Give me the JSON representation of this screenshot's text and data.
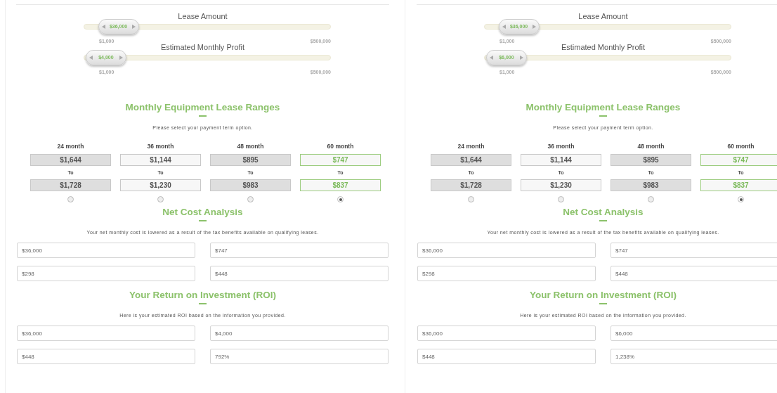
{
  "panels": [
    {
      "sliders": [
        {
          "label": "Lease Amount",
          "value": "$36,000",
          "min": "$1,000",
          "max": "$500,000",
          "level": 0.07
        },
        {
          "label": "Estimated Monthly Profit",
          "value": "$4,000",
          "min": "$1,000",
          "max": "$500,000",
          "level": 0.01
        }
      ],
      "lease_ranges": {
        "title": "Monthly Equipment Lease Ranges",
        "subtitle": "Please select your payment term option.",
        "terms": [
          {
            "label": "24 month",
            "from": "$1,644",
            "separator": "To",
            "to": "$1,728",
            "kind": "shaded",
            "selected": false
          },
          {
            "label": "36 month",
            "from": "$1,144",
            "separator": "To",
            "to": "$1,230",
            "kind": "plain",
            "selected": false
          },
          {
            "label": "48 month",
            "from": "$895",
            "separator": "To",
            "to": "$983",
            "kind": "shaded",
            "selected": false
          },
          {
            "label": "60 month",
            "from": "$747",
            "separator": "To",
            "to": "$837",
            "kind": "plain",
            "selected": true
          }
        ]
      },
      "net_cost": {
        "title": "Net Cost Analysis",
        "subtitle": "Your net monthly cost is lowered as a result of the tax benefits available on qualifying leases.",
        "fields": [
          "$36,000",
          "$747",
          "$298",
          "$448"
        ]
      },
      "roi": {
        "title": "Your Return on Investment (ROI)",
        "subtitle": "Here is your estimated ROI based on the information you provided.",
        "fields": [
          "$36,000",
          "$4,000",
          "$448",
          "792%"
        ]
      }
    },
    {
      "sliders": [
        {
          "label": "Lease Amount",
          "value": "$36,000",
          "min": "$1,000",
          "max": "$500,000",
          "level": 0.07
        },
        {
          "label": "Estimated Monthly Profit",
          "value": "$6,000",
          "min": "$1,000",
          "max": "$500,000",
          "level": 0.01
        }
      ],
      "lease_ranges": {
        "title": "Monthly Equipment Lease Ranges",
        "subtitle": "Please select your payment term option.",
        "terms": [
          {
            "label": "24 month",
            "from": "$1,644",
            "separator": "To",
            "to": "$1,728",
            "kind": "shaded",
            "selected": false
          },
          {
            "label": "36 month",
            "from": "$1,144",
            "separator": "To",
            "to": "$1,230",
            "kind": "plain",
            "selected": false
          },
          {
            "label": "48 month",
            "from": "$895",
            "separator": "To",
            "to": "$983",
            "kind": "shaded",
            "selected": false
          },
          {
            "label": "60 month",
            "from": "$747",
            "separator": "To",
            "to": "$837",
            "kind": "plain",
            "selected": true
          }
        ]
      },
      "net_cost": {
        "title": "Net Cost Analysis",
        "subtitle": "Your net monthly cost is lowered as a result of the tax benefits available on qualifying leases.",
        "fields": [
          "$36,000",
          "$747",
          "$298",
          "$448"
        ]
      },
      "roi": {
        "title": "Your Return on Investment (ROI)",
        "subtitle": "Here is your estimated ROI based on the information you provided.",
        "fields": [
          "$36,000",
          "$6,000",
          "$448",
          "1,238%"
        ]
      }
    }
  ]
}
